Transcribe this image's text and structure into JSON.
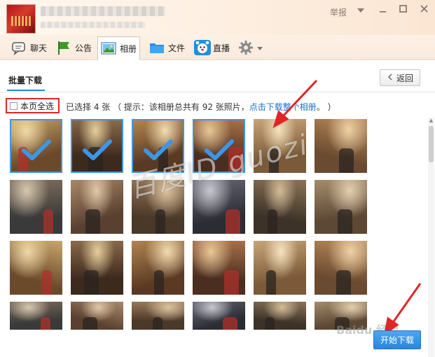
{
  "titlebar": {
    "report_label": "举报",
    "report_menu_icon": "caret-down-icon",
    "minimize_icon": "minimize-icon",
    "maximize_icon": "maximize-icon",
    "close_icon": "close-icon"
  },
  "toolbar": {
    "items": [
      {
        "label": "聊天",
        "icon": "chat-icon"
      },
      {
        "label": "公告",
        "icon": "announcement-flag-icon"
      },
      {
        "label": "相册",
        "icon": "album-icon"
      },
      {
        "label": "文件",
        "icon": "folder-icon"
      },
      {
        "label": "直播",
        "icon": "live-icon"
      }
    ],
    "settings_icon": "gear-icon",
    "settings_menu_icon": "caret-down-icon"
  },
  "batch": {
    "title": "批量下载",
    "back_label": "返回",
    "back_icon": "arrow-left-icon"
  },
  "selection": {
    "select_all_label": "本页全选",
    "info_prefix": "已选择 4 张 （ 提示：该相册总共有 92 张照片，",
    "info_link": "点击下载整个相册",
    "info_suffix": "。 ）"
  },
  "photos": [
    {
      "selected": true
    },
    {
      "selected": true
    },
    {
      "selected": true
    },
    {
      "selected": true
    },
    {
      "selected": false
    },
    {
      "selected": false
    },
    {
      "selected": false
    },
    {
      "selected": false
    },
    {
      "selected": false
    },
    {
      "selected": false
    },
    {
      "selected": false
    },
    {
      "selected": false
    },
    {
      "selected": false
    },
    {
      "selected": false
    },
    {
      "selected": false
    },
    {
      "selected": false
    },
    {
      "selected": false
    },
    {
      "selected": false
    },
    {
      "selected": false
    },
    {
      "selected": false
    },
    {
      "selected": false
    },
    {
      "selected": false
    },
    {
      "selected": false
    },
    {
      "selected": false
    }
  ],
  "actions": {
    "start_download_label": "开始下载"
  },
  "overlay": {
    "watermark_text": "百度ID guozi",
    "site_logo_text": "Baidu 经验"
  },
  "colors": {
    "accent": "#2a85dd",
    "annotation_red": "#e02626"
  }
}
